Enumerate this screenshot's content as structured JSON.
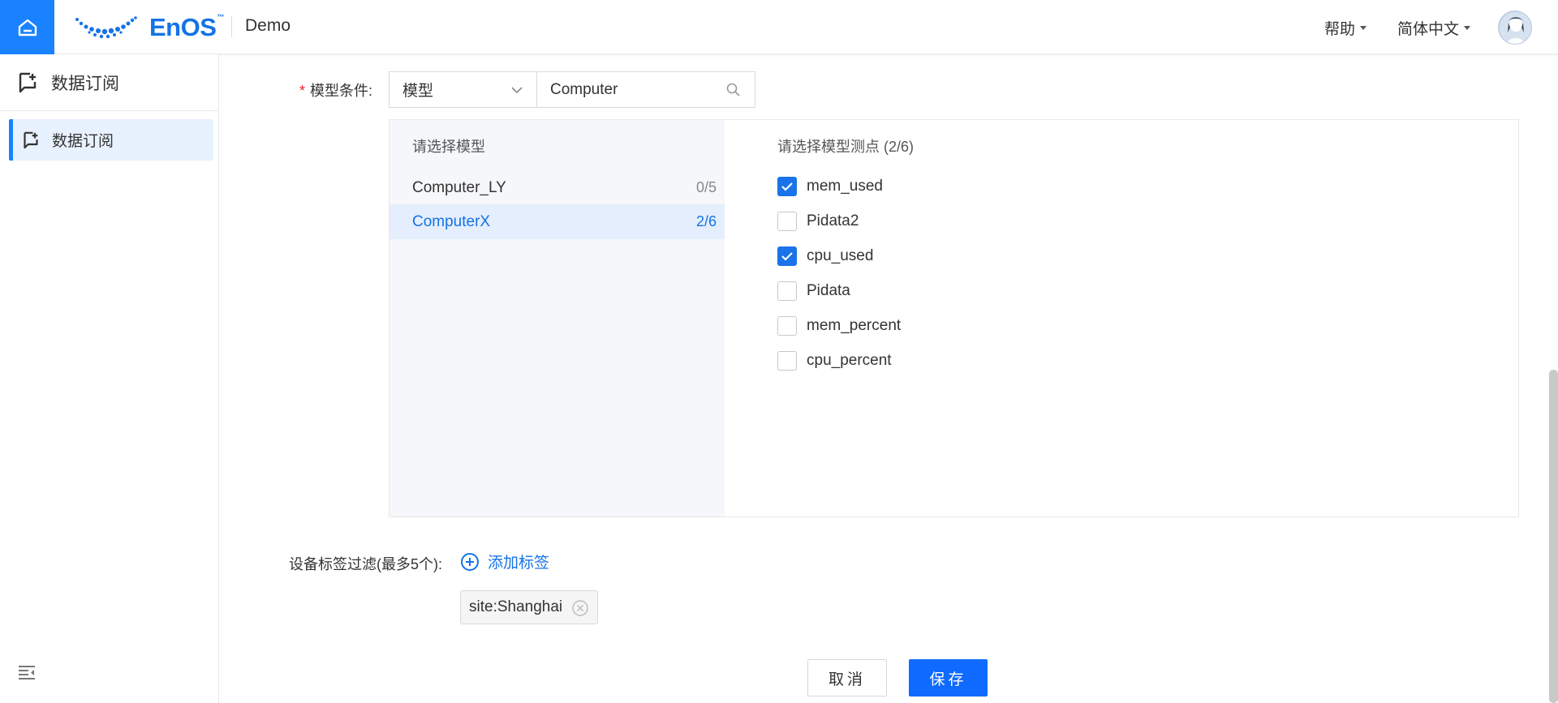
{
  "header": {
    "brand": "EnOS",
    "brand_tm": "™",
    "app_name": "Demo",
    "help_label": "帮助",
    "language_label": "简体中文"
  },
  "sidebar": {
    "title": "数据订阅",
    "items": [
      {
        "label": "数据订阅",
        "active": true
      }
    ]
  },
  "form": {
    "model_condition_label": "模型条件:",
    "model_type_select": "模型",
    "search_value": "Computer",
    "models_pane_title": "请选择模型",
    "models": [
      {
        "name": "Computer_LY",
        "count": "0/5",
        "active": false
      },
      {
        "name": "ComputerX",
        "count": "2/6",
        "active": true
      }
    ],
    "points_pane_title": "请选择模型测点 (2/6)",
    "points": [
      {
        "name": "mem_used",
        "checked": true
      },
      {
        "name": "Pidata2",
        "checked": false
      },
      {
        "name": "cpu_used",
        "checked": true
      },
      {
        "name": "Pidata",
        "checked": false
      },
      {
        "name": "mem_percent",
        "checked": false
      },
      {
        "name": "cpu_percent",
        "checked": false
      }
    ],
    "tag_filter_label": "设备标签过滤(最多5个):",
    "add_tag_label": "添加标签",
    "tags": [
      "site:Shanghai"
    ]
  },
  "actions": {
    "cancel_label": "取消",
    "save_label": "保存"
  },
  "colors": {
    "accent": "#1a82ff",
    "link": "#1473e6",
    "primary_button": "#0f6bff"
  }
}
